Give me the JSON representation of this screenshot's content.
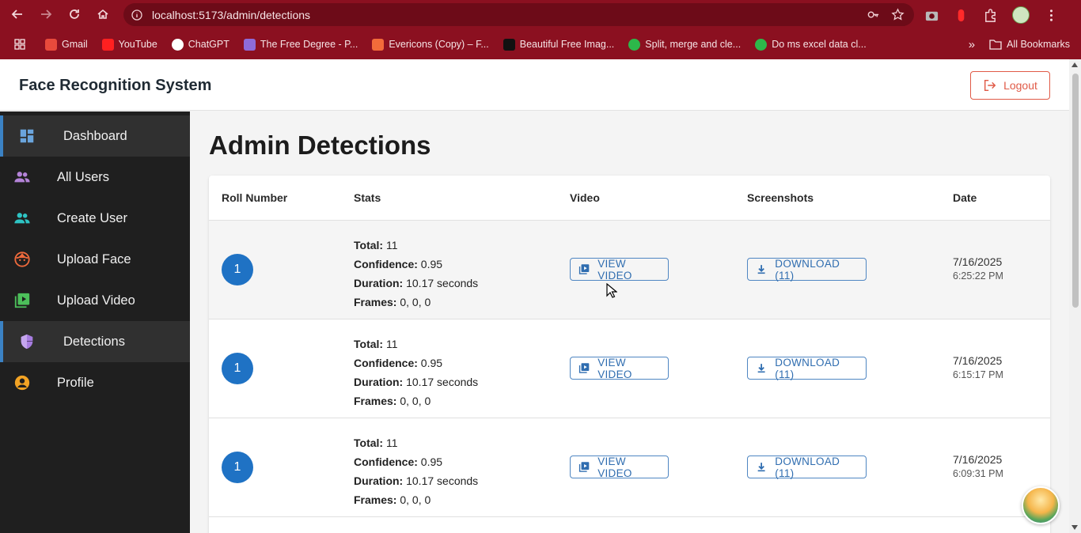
{
  "browser": {
    "url": "localhost:5173/admin/detections",
    "bookmarks": [
      {
        "label": "Gmail",
        "color": "#e84a3c"
      },
      {
        "label": "YouTube",
        "color": "#ff2020"
      },
      {
        "label": "ChatGPT",
        "color": "#ffffff"
      },
      {
        "label": "The Free Degree - P...",
        "color": "#8e6bd8"
      },
      {
        "label": "Evericons (Copy) – F...",
        "color": "#f26b3a"
      },
      {
        "label": "Beautiful Free Imag...",
        "color": "#111111"
      },
      {
        "label": "Split, merge and cle...",
        "color": "#2db84a"
      },
      {
        "label": "Do ms excel data cl...",
        "color": "#2db84a"
      }
    ],
    "all_bookmarks": "All Bookmarks"
  },
  "header": {
    "title": "Face Recognition System",
    "logout": "Logout"
  },
  "sidebar": {
    "items": [
      {
        "label": "Dashboard",
        "icon": "dashboard-icon",
        "color": "#6aa4dc",
        "active": true
      },
      {
        "label": "All Users",
        "icon": "people-icon",
        "color": "#b483d8",
        "active": false
      },
      {
        "label": "Create User",
        "icon": "people-icon",
        "color": "#2ec4c4",
        "active": false
      },
      {
        "label": "Upload Face",
        "icon": "face-icon",
        "color": "#ef6a3c",
        "active": false
      },
      {
        "label": "Upload Video",
        "icon": "video-library-icon",
        "color": "#4cbf5a",
        "active": false
      },
      {
        "label": "Detections",
        "icon": "shield-icon",
        "color": "#a77de0",
        "active": true
      },
      {
        "label": "Profile",
        "icon": "account-circle-icon",
        "color": "#f2a324",
        "active": false
      }
    ]
  },
  "page": {
    "title": "Admin Detections",
    "columns": [
      "Roll Number",
      "Stats",
      "Video",
      "Screenshots",
      "Date"
    ],
    "labels": {
      "total": "Total:",
      "confidence": "Confidence:",
      "duration": "Duration:",
      "frames": "Frames:"
    },
    "rows": [
      {
        "roll": "1",
        "total": "11",
        "confidence": "0.95",
        "duration": "10.17 seconds",
        "frames": "0, 0, 0",
        "video_label": "VIEW VIDEO",
        "download_label": "DOWNLOAD (11)",
        "date": "7/16/2025",
        "time": "6:25:22 PM"
      },
      {
        "roll": "1",
        "total": "11",
        "confidence": "0.95",
        "duration": "10.17 seconds",
        "frames": "0, 0, 0",
        "video_label": "VIEW VIDEO",
        "download_label": "DOWNLOAD (11)",
        "date": "7/16/2025",
        "time": "6:15:17 PM"
      },
      {
        "roll": "1",
        "total": "11",
        "confidence": "0.95",
        "duration": "10.17 seconds",
        "frames": "0, 0, 0",
        "video_label": "VIEW VIDEO",
        "download_label": "DOWNLOAD (11)",
        "date": "7/16/2025",
        "time": "6:09:31 PM"
      }
    ]
  }
}
